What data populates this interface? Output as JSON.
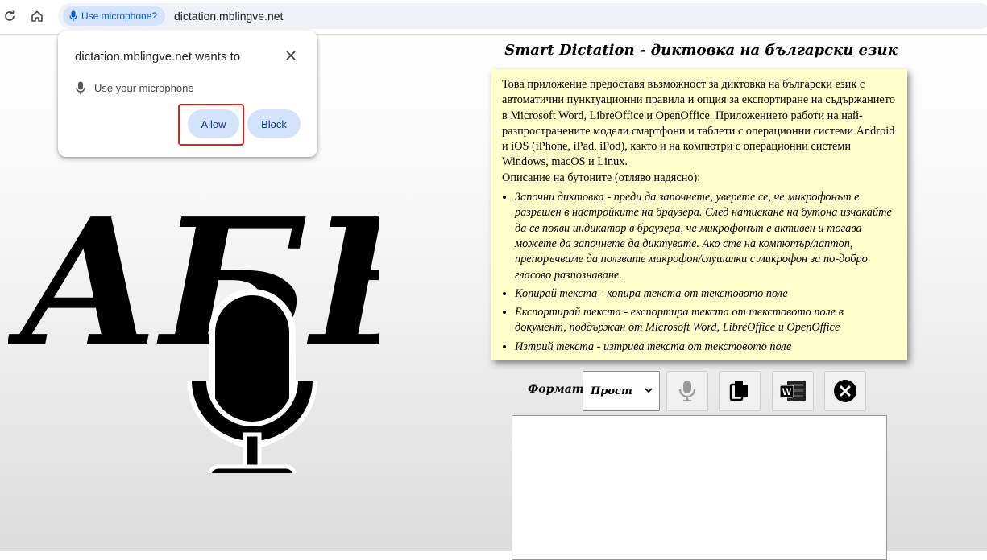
{
  "browser": {
    "mic_chip_label": "Use microphone?",
    "url": "dictation.mblingve.net",
    "reload_icon": "reload-icon",
    "home_icon": "home-icon"
  },
  "permission_popup": {
    "title": "dictation.mblingve.net wants to",
    "request": "Use your microphone",
    "allow_label": "Allow",
    "block_label": "Block"
  },
  "logo": {
    "letters": "АБВ",
    "icon": "microphone-icon"
  },
  "page": {
    "title": "Smart Dictation - диктовка на български език",
    "intro": "Това приложение предоставя възможност за диктовка на български език с автоматични пунктуационни правила и опция за експортиране на съдържанието в Microsoft Word, LibreOffice и OpenOffice. Приложението работи на най-разпространените модели смартфони и таблети с операционни системи Android и iOS (iPhone, iPad, iPod), както и на компютри с операционни системи Windows, macOS и Linux.",
    "buttons_heading": "Описание на бутоните (отляво надясно):",
    "bullets": [
      "Започни диктовка - преди да започнете, уверете се, че микрофонът е разрешен в настройките на браузера. След натискане на бутона изчакайте да се появи индикатор в браузера, че микрофонът е активен и тогава можете да започнете да диктувате. Ако сте на компютър/лаптоп, препоръчваме да ползвате микрофон/слушалки с микрофон за по-добро гласово разпознаване.",
      "Копирай текста - копира текста от текстовото поле",
      "Експортирай текста - експортира текста от текстовото поле в документ, поддържан от Microsoft Word, LibreOffice и OpenOffice",
      "Изтрий текста - изтрива текста от текстовото поле"
    ],
    "format_label": "Формат:",
    "format_selected": "Прост",
    "textarea_value": ""
  },
  "colors": {
    "note_bg": "#ffffcc",
    "chip_bg": "#d3e3fd",
    "highlight": "#e01e1e"
  }
}
